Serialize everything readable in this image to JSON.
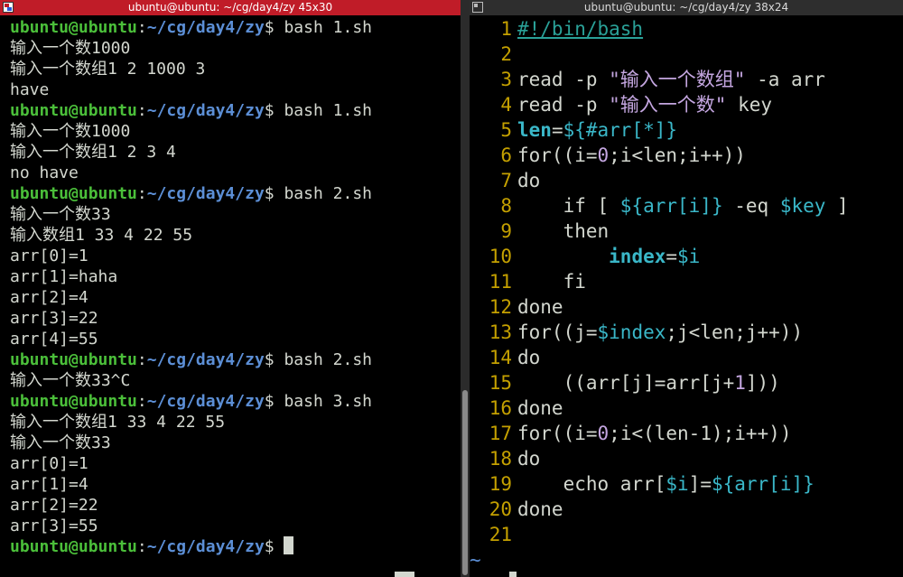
{
  "left_terminal": {
    "title": "ubuntu@ubuntu: ~/cg/day4/zy 45x30",
    "prompt": {
      "user": "ubuntu@ubuntu",
      "colon": ":",
      "path": "~/cg/day4/zy",
      "dollar": "$"
    },
    "lines": [
      {
        "type": "prompt",
        "cmd": " bash 1.sh"
      },
      {
        "type": "out",
        "text": "输入一个数1000"
      },
      {
        "type": "out",
        "text": "输入一个数组1 2 1000 3"
      },
      {
        "type": "out",
        "text": "have"
      },
      {
        "type": "prompt",
        "cmd": " bash 1.sh"
      },
      {
        "type": "out",
        "text": "输入一个数1000"
      },
      {
        "type": "out",
        "text": "输入一个数组1 2 3 4"
      },
      {
        "type": "out",
        "text": "no have"
      },
      {
        "type": "prompt",
        "cmd": " bash 2.sh"
      },
      {
        "type": "out",
        "text": "输入一个数33"
      },
      {
        "type": "out",
        "text": "输入数组1 33 4 22 55"
      },
      {
        "type": "out",
        "text": "arr[0]=1"
      },
      {
        "type": "out",
        "text": "arr[1]=haha"
      },
      {
        "type": "out",
        "text": "arr[2]=4"
      },
      {
        "type": "out",
        "text": "arr[3]=22"
      },
      {
        "type": "out",
        "text": "arr[4]=55"
      },
      {
        "type": "prompt",
        "cmd": " bash 2.sh"
      },
      {
        "type": "out",
        "text": "输入一个数33^C"
      },
      {
        "type": "prompt",
        "cmd": " bash 3.sh"
      },
      {
        "type": "out",
        "text": "输入一个数组1 33 4 22 55"
      },
      {
        "type": "out",
        "text": "输入一个数33"
      },
      {
        "type": "out",
        "text": "arr[0]=1"
      },
      {
        "type": "out",
        "text": "arr[1]=4"
      },
      {
        "type": "out",
        "text": "arr[2]=22"
      },
      {
        "type": "out",
        "text": "arr[3]=55"
      },
      {
        "type": "prompt",
        "cmd": ""
      }
    ]
  },
  "right_terminal": {
    "title": "ubuntu@ubuntu: ~/cg/day4/zy 38x24",
    "line_numbers": [
      "1",
      "2",
      "3",
      "4",
      "5",
      "6",
      "7",
      "8",
      "9",
      "10",
      "11",
      "12",
      "13",
      "14",
      "15",
      "16",
      "17",
      "18",
      "19",
      "20",
      "21"
    ],
    "tilde": "~",
    "code": [
      [
        {
          "c": "sh",
          "t": "#!/bin/bash"
        }
      ],
      [],
      [
        {
          "c": "kw",
          "t": "read -p "
        },
        {
          "c": "str",
          "t": "\"输入一个数组\""
        },
        {
          "c": "kw",
          "t": " -a arr"
        }
      ],
      [
        {
          "c": "kw",
          "t": "read -p "
        },
        {
          "c": "str",
          "t": "\"输入一个数\""
        },
        {
          "c": "kw",
          "t": " key"
        }
      ],
      [
        {
          "c": "var",
          "t": "len"
        },
        {
          "c": "kw",
          "t": "="
        },
        {
          "c": "sub",
          "t": "${#arr[*]}"
        }
      ],
      [
        {
          "c": "kw",
          "t": "for((i="
        },
        {
          "c": "str",
          "t": "0"
        },
        {
          "c": "kw",
          "t": ";i<len;i++))"
        }
      ],
      [
        {
          "c": "kw",
          "t": "do"
        }
      ],
      [
        {
          "c": "kw",
          "t": "    if [ "
        },
        {
          "c": "sub",
          "t": "${arr[i]}"
        },
        {
          "c": "kw",
          "t": " -eq "
        },
        {
          "c": "sub",
          "t": "$key"
        },
        {
          "c": "kw",
          "t": " ]"
        }
      ],
      [
        {
          "c": "kw",
          "t": "    then"
        }
      ],
      [
        {
          "c": "kw",
          "t": "        "
        },
        {
          "c": "var",
          "t": "index"
        },
        {
          "c": "kw",
          "t": "="
        },
        {
          "c": "sub",
          "t": "$i"
        }
      ],
      [
        {
          "c": "kw",
          "t": "    fi"
        }
      ],
      [
        {
          "c": "kw",
          "t": "done"
        }
      ],
      [
        {
          "c": "kw",
          "t": "for((j="
        },
        {
          "c": "sub",
          "t": "$index"
        },
        {
          "c": "kw",
          "t": ";j<len;j++))"
        }
      ],
      [
        {
          "c": "kw",
          "t": "do"
        }
      ],
      [
        {
          "c": "kw",
          "t": "    ((arr[j]=arr[j+"
        },
        {
          "c": "str",
          "t": "1"
        },
        {
          "c": "kw",
          "t": "]))"
        }
      ],
      [
        {
          "c": "kw",
          "t": "done"
        }
      ],
      [
        {
          "c": "kw",
          "t": "for((i="
        },
        {
          "c": "str",
          "t": "0"
        },
        {
          "c": "kw",
          "t": ";i<(len-1);i++))"
        }
      ],
      [
        {
          "c": "kw",
          "t": "do"
        }
      ],
      [
        {
          "c": "kw",
          "t": "    echo arr["
        },
        {
          "c": "sub",
          "t": "$i"
        },
        {
          "c": "kw",
          "t": "]="
        },
        {
          "c": "sub",
          "t": "${arr[i]}"
        }
      ],
      [
        {
          "c": "kw",
          "t": "done"
        }
      ],
      []
    ]
  },
  "colors": {
    "left_titlebar": "#c01c28",
    "right_titlebar": "#2e2e2e",
    "prompt_user": "#4bbf3a",
    "prompt_path": "#5c8fd6",
    "line_number": "#c4a000",
    "string": "#c4a6e0",
    "variable": "#3ab7c8"
  },
  "icons": [
    "terminal-window-icon"
  ]
}
